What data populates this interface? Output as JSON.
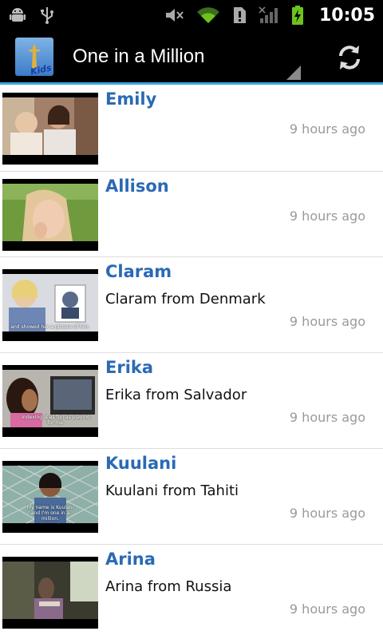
{
  "status_bar": {
    "time": "10:05",
    "icons": [
      "android-debug-icon",
      "usb-icon",
      "mute-icon",
      "wifi-icon",
      "notification-alert-icon",
      "signal-icon",
      "battery-charging-icon"
    ]
  },
  "action_bar": {
    "app_icon": "kids-app-icon",
    "app_icon_text": "Kids",
    "title": "One in a Million",
    "refresh_icon": "refresh-icon",
    "accent": "#35a4e0"
  },
  "videos": [
    {
      "name": "Emily",
      "description": "",
      "time": "9 hours ago",
      "caption": ""
    },
    {
      "name": "Allison",
      "description": "",
      "time": "9 hours ago",
      "caption": ""
    },
    {
      "name": "Claram",
      "description": "Claram from Denmark",
      "time": "9 hours ago",
      "caption": "and showed her a picture of him."
    },
    {
      "name": "Erika",
      "description": "Erika from Salvador",
      "time": "9 hours ago",
      "caption": "Indexing is as fun as playing for me."
    },
    {
      "name": "Kuulani",
      "description": "Kuulani from Tahiti",
      "time": "9 hours ago",
      "caption": "My name is Kuulani and I'm one in a million."
    },
    {
      "name": "Arina",
      "description": "Arina from Russia",
      "time": "9 hours ago",
      "caption": ""
    }
  ],
  "colors": {
    "title_blue": "#2a6ab5",
    "time_gray": "#9a9a9a"
  }
}
